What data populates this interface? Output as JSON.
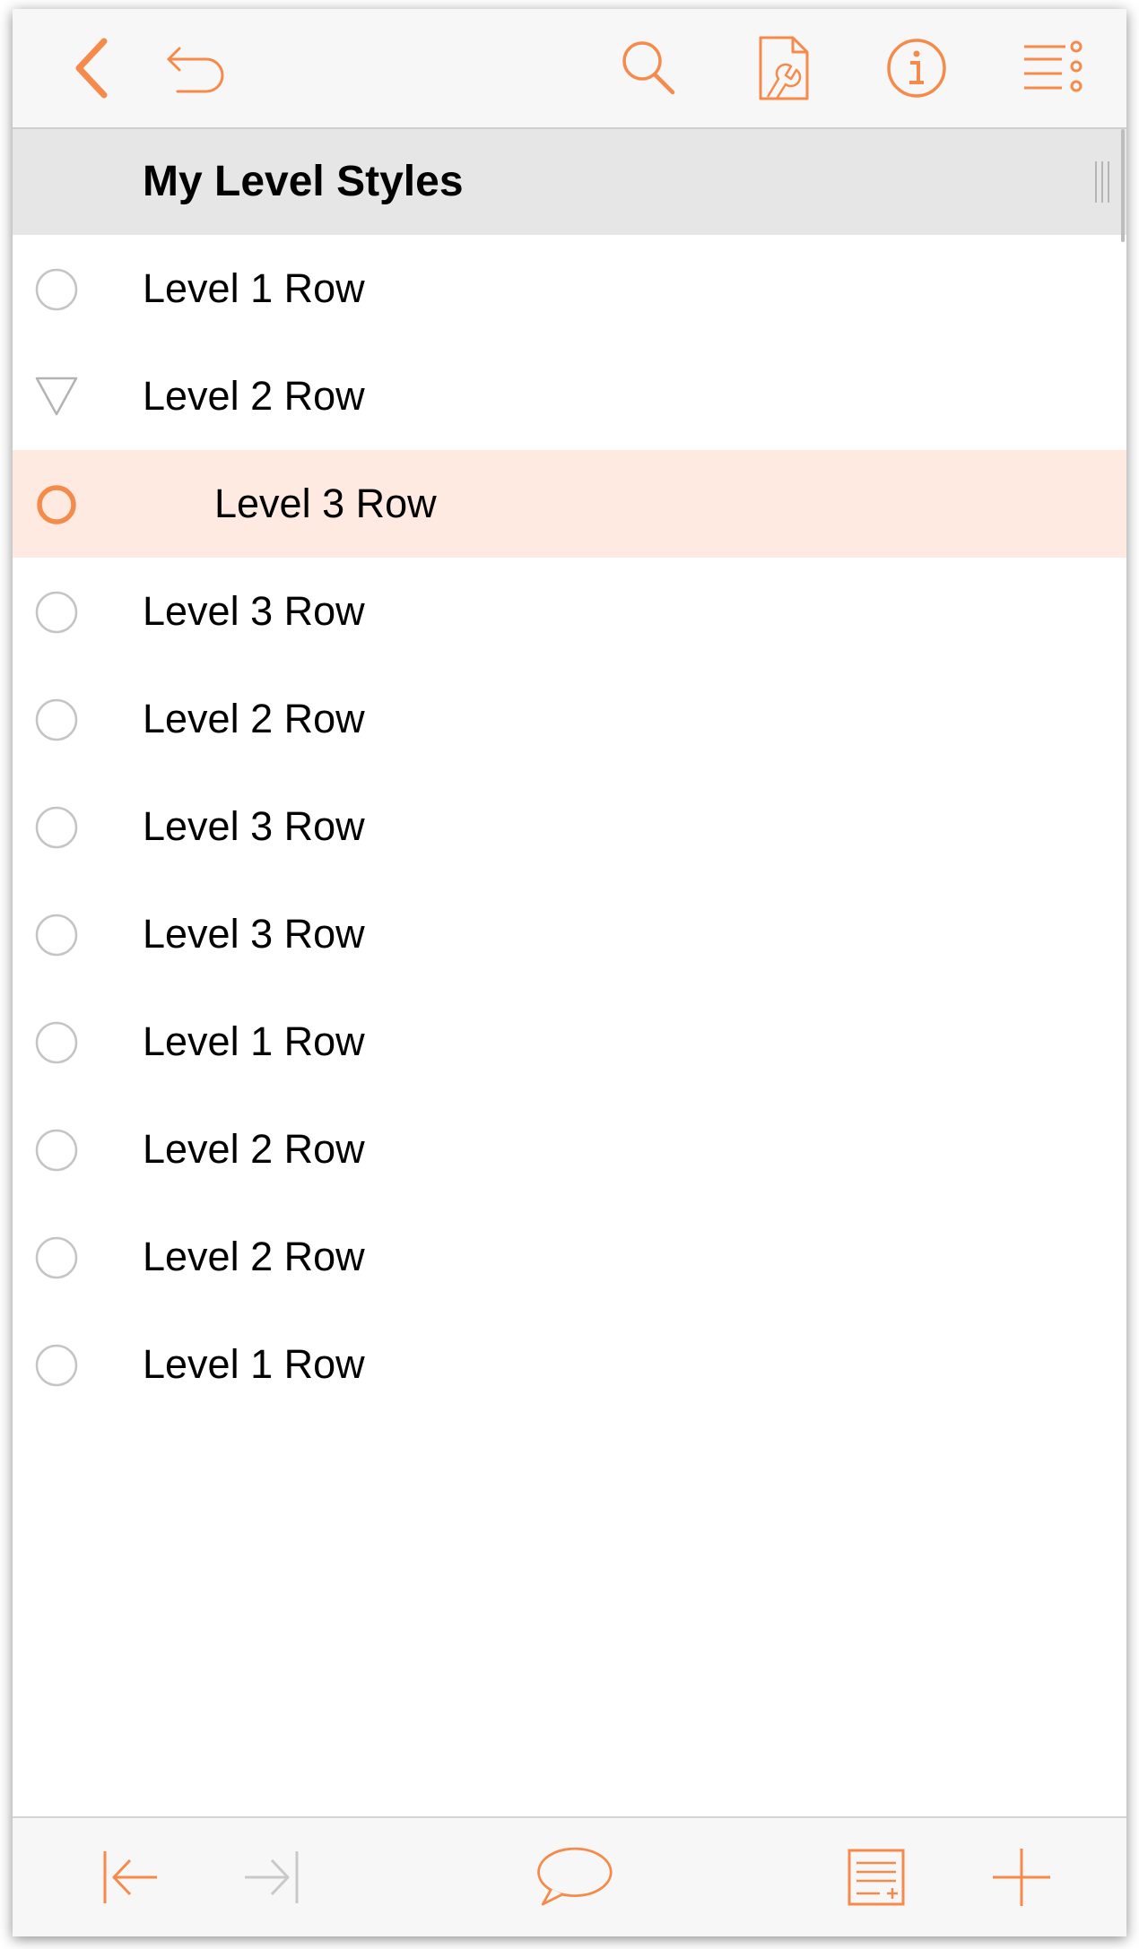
{
  "colors": {
    "accent": "#f58a4b",
    "selected_row_bg": "#feeae1",
    "header_bg": "#e6e6e6",
    "bar_bg": "#f7f7f7",
    "handle_gray": "#c4c4c4"
  },
  "toolbar": {
    "back_icon": "chevron-left-icon",
    "undo_icon": "undo-icon",
    "search_icon": "search-icon",
    "style_icon": "document-wrench-icon",
    "info_icon": "info-icon",
    "menu_icon": "list-options-icon"
  },
  "outline": {
    "title": "My Level Styles",
    "rows": [
      {
        "label": "Level 1 Row",
        "level": 1,
        "handle": "circle",
        "selected": false
      },
      {
        "label": "Level 2 Row",
        "level": 1,
        "handle": "triangle",
        "selected": false
      },
      {
        "label": "Level 3 Row",
        "level": 2,
        "handle": "circle",
        "selected": true
      },
      {
        "label": "Level 3 Row",
        "level": 1,
        "handle": "circle",
        "selected": false
      },
      {
        "label": "Level 2 Row",
        "level": 1,
        "handle": "circle",
        "selected": false
      },
      {
        "label": "Level 3 Row",
        "level": 1,
        "handle": "circle",
        "selected": false
      },
      {
        "label": "Level 3 Row",
        "level": 1,
        "handle": "circle",
        "selected": false
      },
      {
        "label": "Level 1 Row",
        "level": 1,
        "handle": "circle",
        "selected": false
      },
      {
        "label": "Level 2 Row",
        "level": 1,
        "handle": "circle",
        "selected": false
      },
      {
        "label": "Level 2 Row",
        "level": 1,
        "handle": "circle",
        "selected": false
      },
      {
        "label": "Level 1 Row",
        "level": 1,
        "handle": "circle",
        "selected": false
      }
    ]
  },
  "bottombar": {
    "outdent_icon": "outdent-icon",
    "indent_icon": "indent-icon",
    "note_icon": "speech-bubble-icon",
    "add_child_icon": "add-row-icon",
    "add_icon": "plus-icon"
  }
}
